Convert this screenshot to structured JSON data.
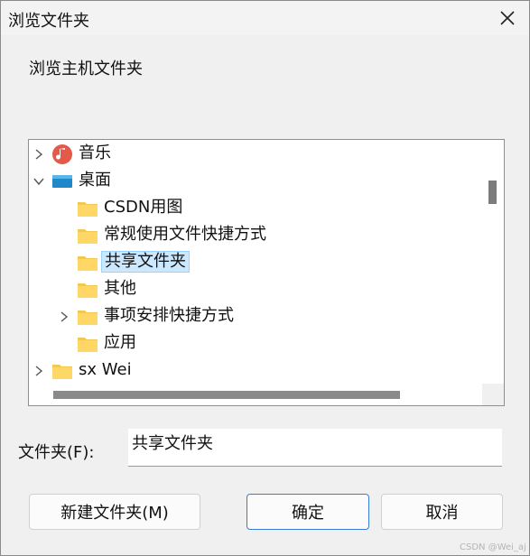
{
  "window": {
    "title": "浏览文件夹"
  },
  "description": "浏览主机文件夹",
  "tree": {
    "items": [
      {
        "label": "音乐",
        "icon": "music-icon",
        "expand": "collapsed"
      },
      {
        "label": "桌面",
        "icon": "desktop-icon",
        "expand": "expanded"
      },
      {
        "label": "CSDN用图",
        "icon": "folder-icon",
        "expand": "none"
      },
      {
        "label": "常规使用文件快捷方式",
        "icon": "folder-icon",
        "expand": "none"
      },
      {
        "label": "共享文件夹",
        "icon": "folder-icon",
        "expand": "none",
        "selected": true
      },
      {
        "label": "其他",
        "icon": "folder-icon",
        "expand": "none"
      },
      {
        "label": "事项安排快捷方式",
        "icon": "folder-icon",
        "expand": "collapsed"
      },
      {
        "label": "应用",
        "icon": "folder-icon",
        "expand": "none"
      },
      {
        "label": "sx Wei",
        "icon": "folder-icon",
        "expand": "collapsed"
      }
    ]
  },
  "folder_field": {
    "label": "文件夹(F):",
    "value": "共享文件夹"
  },
  "buttons": {
    "new_folder": "新建文件夹(M)",
    "ok": "确定",
    "cancel": "取消"
  },
  "watermark": "CSDN @Wei_aj",
  "colors": {
    "selection_bg": "#cce8ff",
    "selection_border": "#99d1ff",
    "primary_border": "#3a7bd5",
    "folder": "#ffd766"
  }
}
